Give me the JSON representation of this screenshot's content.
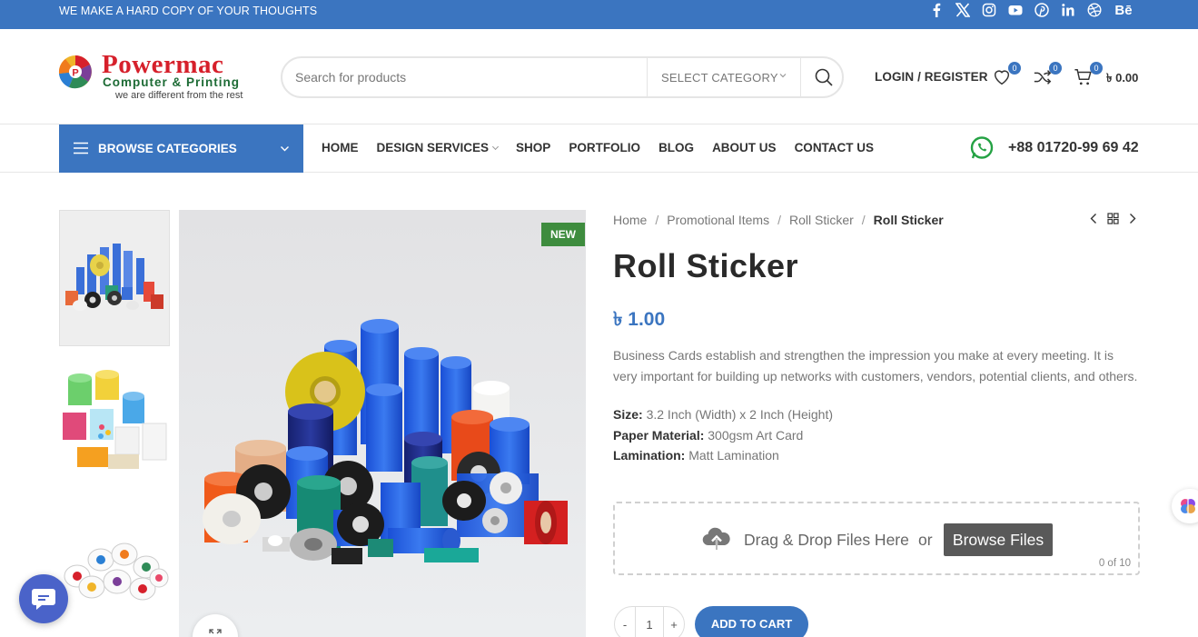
{
  "topbar": {
    "tagline": "WE MAKE A HARD COPY OF YOUR THOUGHTS",
    "social_icons": [
      "facebook-icon",
      "x-icon",
      "instagram-icon",
      "youtube-icon",
      "pinterest-icon",
      "linkedin-icon",
      "dribbble-icon",
      "behance-icon"
    ],
    "behance_label": "Bē"
  },
  "header": {
    "logo": {
      "brand": "Powermac",
      "subtitle": "Computer & Printing",
      "motto": "we are different from the rest"
    },
    "search": {
      "placeholder": "Search for products",
      "category_label": "SELECT CATEGORY"
    },
    "login_label": "LOGIN / REGISTER",
    "wishlist_count": "0",
    "compare_count": "0",
    "cart_count": "0",
    "cart_total": "৳ 0.00"
  },
  "nav": {
    "browse_label": "BROWSE CATEGORIES",
    "items": [
      {
        "label": "HOME"
      },
      {
        "label": "DESIGN SERVICES"
      },
      {
        "label": "SHOP"
      },
      {
        "label": "PORTFOLIO"
      },
      {
        "label": "BLOG"
      },
      {
        "label": "ABOUT US"
      },
      {
        "label": "CONTACT US"
      }
    ],
    "phone": "+88 01720-99 69 42"
  },
  "product": {
    "badge": "NEW",
    "breadcrumb": [
      "Home",
      "Promotional Items",
      "Roll Sticker",
      "Roll Sticker"
    ],
    "title": "Roll Sticker",
    "price": "৳ 1.00",
    "description": "Business Cards establish and strengthen the impression you make at every meeting. It is very important for building up networks with customers, vendors, potential clients, and others.",
    "specs": [
      {
        "label": "Size:",
        "value": " 3.2 Inch (Width) x 2 Inch (Height)"
      },
      {
        "label": "Paper Material:",
        "value": " 300gsm Art Card"
      },
      {
        "label": "Lamination:",
        "value": " Matt Lamination"
      }
    ],
    "upload": {
      "drag_text": "Drag & Drop Files Here",
      "or_text": "or",
      "browse_label": "Browse Files",
      "count_text": "0 of 10"
    },
    "quantity": {
      "minus": "-",
      "value": "1",
      "plus": "+"
    },
    "add_to_cart": "ADD TO CART"
  },
  "colors": {
    "primary": "#3b75c0",
    "new_badge": "#3e8c3e",
    "logo_red": "#d6202b",
    "logo_green": "#1d6b35",
    "chat": "#4a63c9"
  }
}
